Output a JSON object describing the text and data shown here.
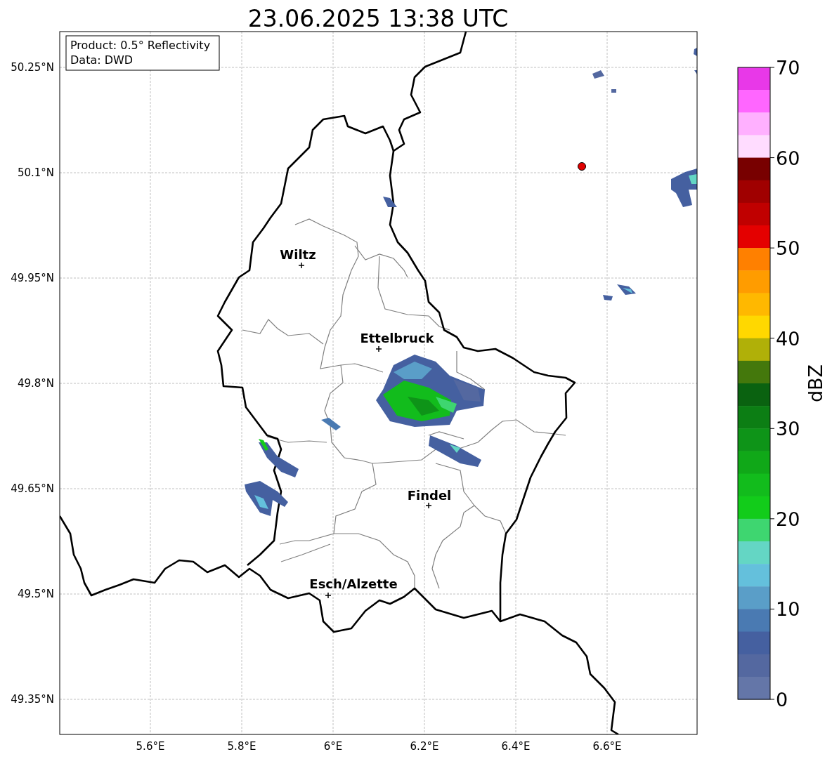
{
  "title": "23.06.2025 13:38 UTC",
  "info_box": {
    "lines": [
      "Product: 0.5° Reflectivity",
      "Data: DWD"
    ]
  },
  "map": {
    "lat_ticks": [
      "50.25°N",
      "50.1°N",
      "49.95°N",
      "49.8°N",
      "49.65°N",
      "49.5°N",
      "49.35°N"
    ],
    "lon_ticks": [
      "5.6°E",
      "5.8°E",
      "6°E",
      "6.2°E",
      "6.4°E",
      "6.6°E"
    ],
    "cities": [
      {
        "name": "Wiltz"
      },
      {
        "name": "Ettelbruck"
      },
      {
        "name": "Findel"
      },
      {
        "name": "Esch/Alzette"
      }
    ]
  },
  "colorbar": {
    "label": "dBZ",
    "ticks": [
      "70",
      "60",
      "50",
      "40",
      "30",
      "20",
      "10",
      "0"
    ],
    "bins": [
      {
        "color": "#e838e8"
      },
      {
        "color": "#ff66ff"
      },
      {
        "color": "#ffb0ff"
      },
      {
        "color": "#ffdcff"
      },
      {
        "color": "#780000"
      },
      {
        "color": "#a00000"
      },
      {
        "color": "#c00000"
      },
      {
        "color": "#e40000"
      },
      {
        "color": "#ff8000"
      },
      {
        "color": "#ff9c00"
      },
      {
        "color": "#ffb800"
      },
      {
        "color": "#ffd800"
      },
      {
        "color": "#b0b008"
      },
      {
        "color": "#44780c"
      },
      {
        "color": "#0a6210"
      },
      {
        "color": "#0c7e14"
      },
      {
        "color": "#0e9418"
      },
      {
        "color": "#10a818"
      },
      {
        "color": "#12bc1c"
      },
      {
        "color": "#12cc1a"
      },
      {
        "color": "#3ed670"
      },
      {
        "color": "#64d6c4"
      },
      {
        "color": "#64c0dc"
      },
      {
        "color": "#5a9ec8"
      },
      {
        "color": "#4a7ab2"
      },
      {
        "color": "#4560a0"
      },
      {
        "color": "#5468a0"
      },
      {
        "color": "#6476a8"
      }
    ]
  }
}
